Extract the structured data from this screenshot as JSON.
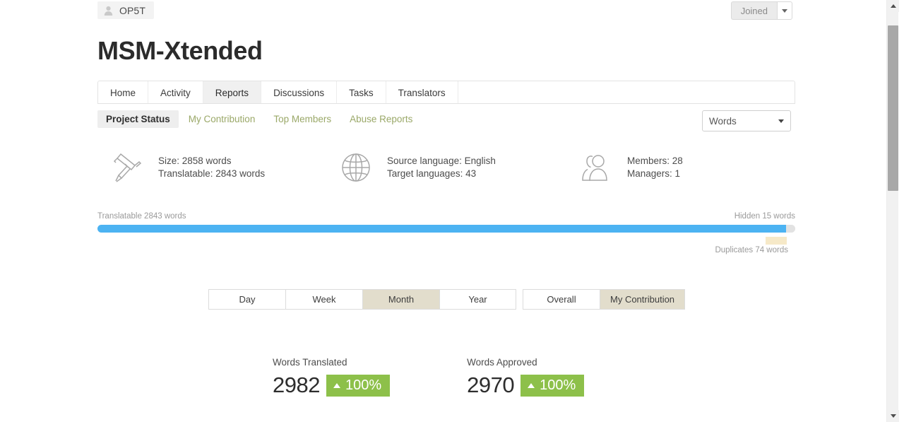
{
  "owner": {
    "name": "OP5T",
    "avatar_icon": "person-icon"
  },
  "header": {
    "joined_label": "Joined",
    "joined_caret_icon": "chevron-down-icon",
    "project_title": "MSM-Xtended"
  },
  "tabs": [
    {
      "label": "Home",
      "active": false
    },
    {
      "label": "Activity",
      "active": false
    },
    {
      "label": "Reports",
      "active": true
    },
    {
      "label": "Discussions",
      "active": false
    },
    {
      "label": "Tasks",
      "active": false
    },
    {
      "label": "Translators",
      "active": false
    }
  ],
  "subtabs": [
    {
      "label": "Project Status",
      "active": true
    },
    {
      "label": "My Contribution",
      "active": false
    },
    {
      "label": "Top Members",
      "active": false
    },
    {
      "label": "Abuse Reports",
      "active": false
    }
  ],
  "unit_select": {
    "value": "Words",
    "caret_icon": "chevron-down-icon"
  },
  "stats": [
    {
      "icon": "caliper-icon",
      "line1": "Size: 2858 words",
      "line2": "Translatable: 2843 words"
    },
    {
      "icon": "globe-icon",
      "line1": "Source language: English",
      "line2": "Target languages: 43"
    },
    {
      "icon": "users-icon",
      "line1": "Members: 28",
      "line2": "Managers: 1"
    }
  ],
  "progress": {
    "left_label": "Translatable 2843 words",
    "right_label": "Hidden 15 words",
    "duplicates_label": "Duplicates 74 words",
    "fill_color": "#4cb3f2",
    "hidden_color": "#e2e2e2",
    "duplicates_color": "#f6e9c8"
  },
  "period_buttons": [
    {
      "label": "Day",
      "active": false
    },
    {
      "label": "Week",
      "active": false
    },
    {
      "label": "Month",
      "active": true
    },
    {
      "label": "Year",
      "active": false
    }
  ],
  "scope_buttons": [
    {
      "label": "Overall",
      "active": false
    },
    {
      "label": "My Contribution",
      "active": true
    }
  ],
  "metrics": [
    {
      "label": "Words Translated",
      "value": "2982",
      "delta": "100%",
      "trend_icon": "triangle-up-icon",
      "badge_color": "#8dc04a"
    },
    {
      "label": "Words Approved",
      "value": "2970",
      "delta": "100%",
      "trend_icon": "triangle-up-icon",
      "badge_color": "#8dc04a"
    }
  ],
  "scrollbar": {
    "up_icon": "scroll-up-arrow-icon",
    "down_icon": "scroll-down-arrow-icon"
  }
}
